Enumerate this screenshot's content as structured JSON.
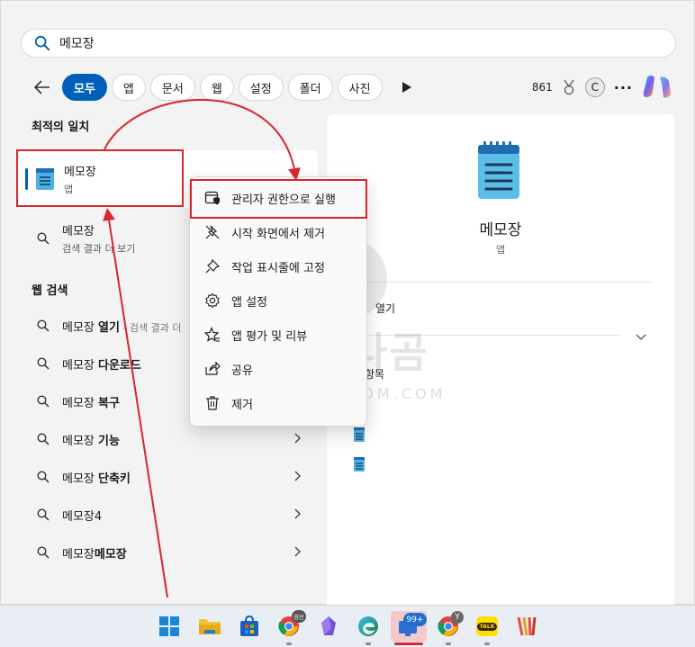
{
  "search": {
    "value": "메모장"
  },
  "filters": {
    "chips": [
      "모두",
      "앱",
      "문서",
      "웹",
      "설정",
      "폴더",
      "사진"
    ],
    "points": "861",
    "account_initial": "C"
  },
  "left": {
    "best_match_title": "최적의 일치",
    "best_match": {
      "name": "메모장",
      "type": "앱"
    },
    "search_row": {
      "name": "메모장",
      "sub": "검색 결과 더 보기"
    },
    "web_title": "웹 검색",
    "web_items": [
      {
        "base": "메모장 ",
        "bold": "열기",
        "dim": " - 검색 결과 더"
      },
      {
        "base": "메모장 ",
        "bold": "다운로드",
        "dim": ""
      },
      {
        "base": "메모장 ",
        "bold": "복구",
        "dim": ""
      },
      {
        "base": "메모장 ",
        "bold": "기능",
        "dim": ""
      },
      {
        "base": "메모장 ",
        "bold": "단축키",
        "dim": ""
      },
      {
        "base": "메모장",
        "bold": "4",
        "dim": ""
      },
      {
        "base": "메모장",
        "bold": "메모장",
        "dim": ""
      }
    ]
  },
  "right": {
    "app_name": "메모장",
    "app_type": "앱",
    "open_label": "열기",
    "recent_label": "항목"
  },
  "context_menu": {
    "items": [
      {
        "label": "관리자 권한으로 실행",
        "icon": "shield-window-icon"
      },
      {
        "label": "시작 화면에서 제거",
        "icon": "unpin-icon"
      },
      {
        "label": "작업 표시줄에 고정",
        "icon": "pin-icon"
      },
      {
        "label": "앱 설정",
        "icon": "gear-icon"
      },
      {
        "label": "앱 평가 및 리뷰",
        "icon": "star-review-icon"
      },
      {
        "label": "공유",
        "icon": "share-icon"
      },
      {
        "label": "제거",
        "icon": "trash-icon"
      }
    ]
  },
  "watermark": {
    "text": "안테나곰",
    "sub": "ANTENNAGOM.COM"
  },
  "taskbar": {
    "chrome_badge": "음진",
    "teams_badge": "99+",
    "chrome2_badge": "Y",
    "kakao_label": "TALK"
  },
  "colors": {
    "accent": "#005fb8",
    "highlight": "#d8262d"
  }
}
